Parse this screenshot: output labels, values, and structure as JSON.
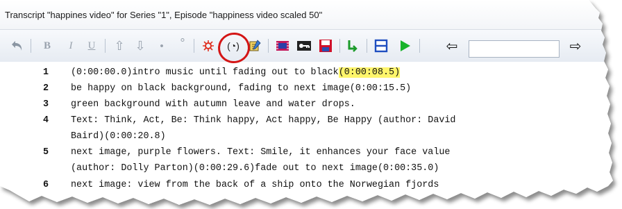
{
  "window": {
    "title": "Transcript \"happines video\" for Series \"1\", Episode \"happiness video scaled 50\""
  },
  "toolbar": {
    "buttons": [
      {
        "name": "undo-icon",
        "glyph": "↶"
      },
      {
        "name": "bold-icon",
        "glyph": "B"
      },
      {
        "name": "italic-icon",
        "glyph": "I"
      },
      {
        "name": "underline-icon",
        "glyph": "U"
      },
      {
        "name": "arrow-up-icon",
        "glyph": "⇧"
      },
      {
        "name": "arrow-down-icon",
        "glyph": "⇩"
      },
      {
        "name": "dot-small-icon",
        "glyph": "•"
      },
      {
        "name": "degree-icon",
        "glyph": "°"
      },
      {
        "name": "bug-icon",
        "glyph": "✲"
      },
      {
        "name": "timecode-icon",
        "glyph": "(◔)"
      },
      {
        "name": "edit-timecode-icon",
        "glyph": "✎"
      },
      {
        "name": "video-icon",
        "glyph": "▣"
      },
      {
        "name": "key-icon",
        "glyph": "⚿"
      },
      {
        "name": "save-icon",
        "glyph": "🖫"
      },
      {
        "name": "check-icon",
        "glyph": "✓"
      },
      {
        "name": "split-icon",
        "glyph": "☰"
      },
      {
        "name": "play-icon",
        "glyph": "▶"
      }
    ],
    "nav_back_glyph": "⇦",
    "nav_forward_glyph": "⇨",
    "search_value": ""
  },
  "transcript": {
    "lines": [
      {
        "num": "1",
        "text": "(0:00:00.0)intro music until fading out to black",
        "highlight": "(0:00:08.5)"
      },
      {
        "num": "2",
        "text": "be happy on black background, fading to next image(0:00:15.5)",
        "highlight": ""
      },
      {
        "num": "3",
        "text": "green background with autumn leave and water drops.",
        "highlight": ""
      },
      {
        "num": "4",
        "text": "Text: Think, Act, Be: Think happy, Act happy, Be Happy (author: David",
        "highlight": ""
      },
      {
        "num": "",
        "text": "Baird)(0:00:20.8)",
        "highlight": ""
      },
      {
        "num": "5",
        "text": "next image, purple flowers. Text: Smile, it enhances your face value",
        "highlight": ""
      },
      {
        "num": "",
        "text": "(author: Dolly Parton)(0:00:29.6)fade out to next image(0:00:35.0)",
        "highlight": ""
      },
      {
        "num": "6",
        "text": "next image: view from the back of a ship onto the Norwegian fjords",
        "highlight": ""
      }
    ]
  },
  "colors": {
    "highlight": "#fff56b",
    "annotation_circle": "#d41515"
  }
}
